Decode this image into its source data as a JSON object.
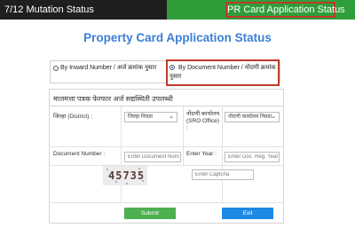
{
  "tabs": {
    "mutation_status": "7/12 Mutation Status",
    "pr_card_status": "PR Card Application Status"
  },
  "title": "Property Card Application Status",
  "search_mode": {
    "option_inward": "By Inward Number / अर्ज क्रमांक नुसार",
    "option_document": "By Document Number / नोंदणी क्रमांक नुसार",
    "selected": "document"
  },
  "form": {
    "heading": "मालमत्ता पत्रक फेरफार अर्ज सद्यस्थिती उपलब्धी",
    "district_label": "जिल्हा (District) :",
    "district_value": "जिल्हा निवडा",
    "sro_label": "नोंदणी कार्यालय (SRO Office) :",
    "sro_value": "नोंदणी कार्यालय निवडा",
    "document_label": "Document Number :",
    "document_placeholder": "Enter Document Num",
    "year_label": "Enter Year :",
    "year_placeholder": "Enter Doc. Reg. Year",
    "captcha_text": "45735",
    "captcha_placeholder": "Enter Captcha",
    "submit_label": "Submit",
    "exit_label": "Exit"
  },
  "colors": {
    "active_tab": "#2f9e3a",
    "inactive_tab": "#1f1f1f",
    "highlight_border": "#c0392b",
    "title": "#3b7fd6",
    "submit": "#4caf50",
    "exit": "#1e88e5"
  },
  "icons": {
    "dropdown": "chevron-down-icon",
    "radio": "radio-button-icon"
  }
}
